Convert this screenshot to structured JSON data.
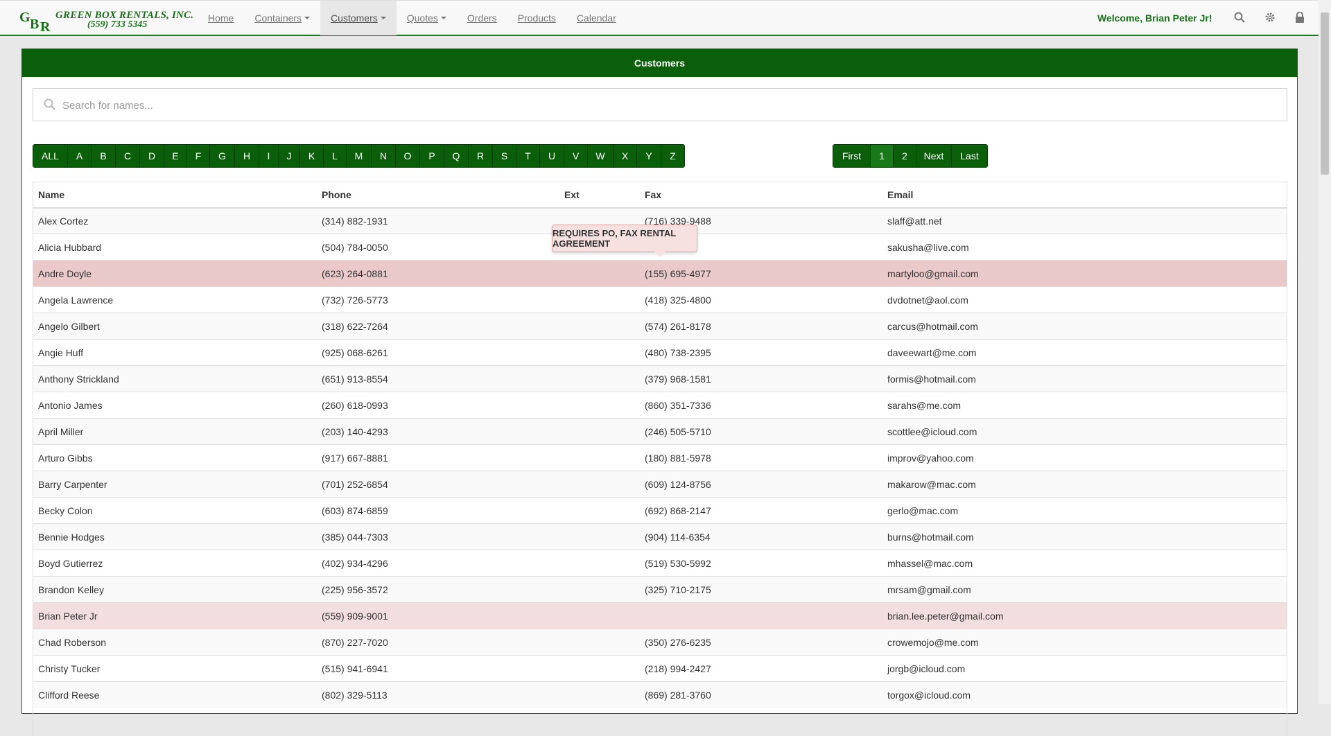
{
  "brand": {
    "initials": [
      "G",
      "B",
      "R"
    ],
    "name": "GREEN BOX RENTALS, INC.",
    "phone": "(559) 733 5345"
  },
  "nav": {
    "items": [
      {
        "label": "Home",
        "dropdown": false,
        "active": false
      },
      {
        "label": "Containers",
        "dropdown": true,
        "active": false
      },
      {
        "label": "Customers",
        "dropdown": true,
        "active": true
      },
      {
        "label": "Quotes",
        "dropdown": true,
        "active": false
      },
      {
        "label": "Orders",
        "dropdown": false,
        "active": false
      },
      {
        "label": "Products",
        "dropdown": false,
        "active": false
      },
      {
        "label": "Calendar",
        "dropdown": false,
        "active": false
      }
    ],
    "welcome": "Welcome, Brian Peter Jr!",
    "icons": [
      "search-icon",
      "gear-icon",
      "lock-icon"
    ]
  },
  "panel": {
    "title": "Customers",
    "search_placeholder": "Search for names...",
    "letters": [
      "ALL",
      "A",
      "B",
      "C",
      "D",
      "E",
      "F",
      "G",
      "H",
      "I",
      "J",
      "K",
      "L",
      "M",
      "N",
      "O",
      "P",
      "Q",
      "R",
      "S",
      "T",
      "U",
      "V",
      "W",
      "X",
      "Y",
      "Z"
    ],
    "pagination": {
      "first": "First",
      "pages": [
        "1",
        "2"
      ],
      "current": "1",
      "next": "Next",
      "last": "Last"
    }
  },
  "table": {
    "headers": [
      "Name",
      "Phone",
      "Ext",
      "Fax",
      "Email"
    ],
    "rows": [
      {
        "name": "Alex Cortez",
        "phone": "(314) 882-1931",
        "ext": "",
        "fax": "(716) 339-9488",
        "email": "slaff@att.net",
        "flag": ""
      },
      {
        "name": "Alicia Hubbard",
        "phone": "(504) 784-0050",
        "ext": "",
        "fax": "",
        "email": "sakusha@live.com",
        "flag": ""
      },
      {
        "name": "Andre Doyle",
        "phone": "(623) 264-0881",
        "ext": "",
        "fax": "(155) 695-4977",
        "email": "martyloo@gmail.com",
        "flag": "flag"
      },
      {
        "name": "Angela Lawrence",
        "phone": "(732) 726-5773",
        "ext": "",
        "fax": "(418) 325-4800",
        "email": "dvdotnet@aol.com",
        "flag": ""
      },
      {
        "name": "Angelo Gilbert",
        "phone": "(318) 622-7264",
        "ext": "",
        "fax": "(574) 261-8178",
        "email": "carcus@hotmail.com",
        "flag": ""
      },
      {
        "name": "Angie Huff",
        "phone": "(925) 068-6261",
        "ext": "",
        "fax": "(480) 738-2395",
        "email": "daveewart@me.com",
        "flag": ""
      },
      {
        "name": "Anthony Strickland",
        "phone": "(651) 913-8554",
        "ext": "",
        "fax": "(379) 968-1581",
        "email": "formis@hotmail.com",
        "flag": ""
      },
      {
        "name": "Antonio James",
        "phone": "(260) 618-0993",
        "ext": "",
        "fax": "(860) 351-7336",
        "email": "sarahs@me.com",
        "flag": ""
      },
      {
        "name": "April Miller",
        "phone": "(203) 140-4293",
        "ext": "",
        "fax": "(246) 505-5710",
        "email": "scottlee@icloud.com",
        "flag": ""
      },
      {
        "name": "Arturo Gibbs",
        "phone": "(917) 667-8881",
        "ext": "",
        "fax": "(180) 881-5978",
        "email": "improv@yahoo.com",
        "flag": ""
      },
      {
        "name": "Barry Carpenter",
        "phone": "(701) 252-6854",
        "ext": "",
        "fax": "(609) 124-8756",
        "email": "makarow@mac.com",
        "flag": ""
      },
      {
        "name": "Becky Colon",
        "phone": "(603) 874-6859",
        "ext": "",
        "fax": "(692) 868-2147",
        "email": "gerlo@mac.com",
        "flag": ""
      },
      {
        "name": "Bennie Hodges",
        "phone": "(385) 044-7303",
        "ext": "",
        "fax": "(904) 114-6354",
        "email": "burns@hotmail.com",
        "flag": ""
      },
      {
        "name": "Boyd Gutierrez",
        "phone": "(402) 934-4296",
        "ext": "",
        "fax": "(519) 530-5992",
        "email": "mhassel@mac.com",
        "flag": ""
      },
      {
        "name": "Brandon Kelley",
        "phone": "(225) 956-3572",
        "ext": "",
        "fax": "(325) 710-2175",
        "email": "mrsam@gmail.com",
        "flag": ""
      },
      {
        "name": "Brian Peter Jr",
        "phone": "(559) 909-9001",
        "ext": "",
        "fax": "",
        "email": "brian.lee.peter@gmail.com",
        "flag": "flag-light"
      },
      {
        "name": "Chad Roberson",
        "phone": "(870) 227-7020",
        "ext": "",
        "fax": "(350) 276-6235",
        "email": "crowemojo@me.com",
        "flag": ""
      },
      {
        "name": "Christy Tucker",
        "phone": "(515) 941-6941",
        "ext": "",
        "fax": "(218) 994-2427",
        "email": "jorgb@icloud.com",
        "flag": ""
      },
      {
        "name": "Clifford Reese",
        "phone": "(802) 329-5113",
        "ext": "",
        "fax": "(869) 281-3760",
        "email": "torgox@icloud.com",
        "flag": ""
      }
    ]
  },
  "tooltip": {
    "text": "REQUIRES PO, FAX RENTAL AGREEMENT"
  },
  "colors": {
    "brand_green": "#1a6f1a",
    "button_green": "#0b5f0b",
    "flag_row": "#e9c9c9"
  }
}
